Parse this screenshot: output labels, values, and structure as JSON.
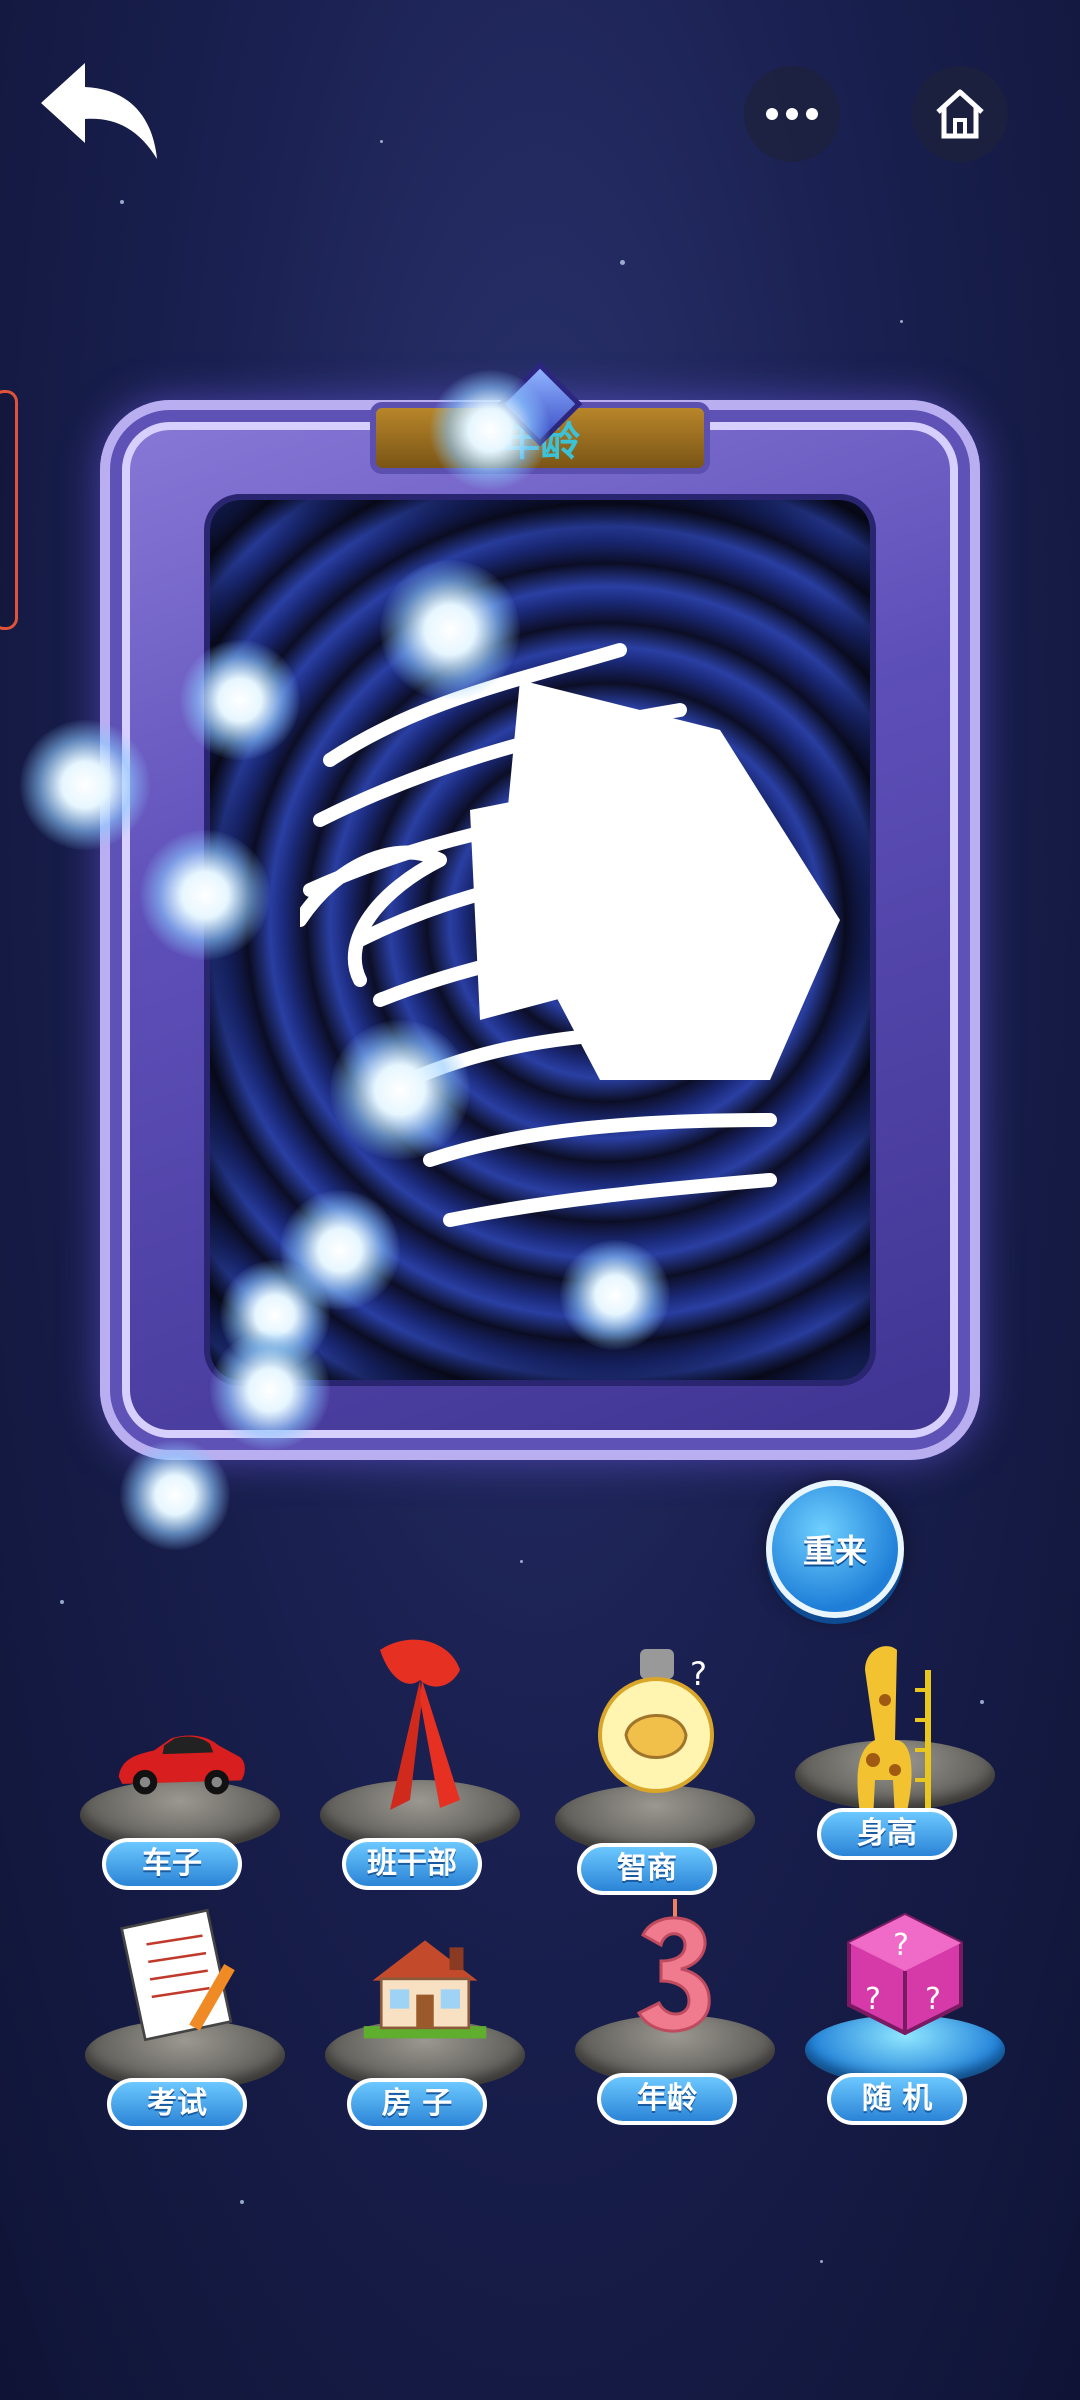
{
  "frame": {
    "title": "年龄"
  },
  "restart_label": "重来",
  "categories": [
    {
      "label": "车子",
      "icon": "car-icon"
    },
    {
      "label": "班干部",
      "icon": "red-scarf-icon"
    },
    {
      "label": "智商",
      "icon": "lightbulb-brain-icon"
    },
    {
      "label": "身高",
      "icon": "giraffe-icon"
    },
    {
      "label": "考试",
      "icon": "exam-paper-icon"
    },
    {
      "label": "房 子",
      "icon": "house-icon"
    },
    {
      "label": "年龄",
      "icon": "number-3-candle-icon"
    },
    {
      "label": "随 机",
      "icon": "random-dice-icon"
    }
  ],
  "colors": {
    "accent": "#2b84d6",
    "frame": "#5d4fb8"
  }
}
